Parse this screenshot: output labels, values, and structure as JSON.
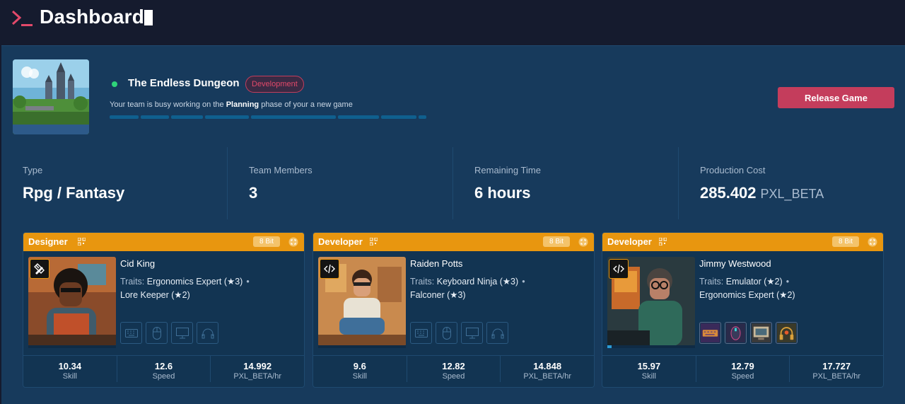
{
  "header": {
    "title": "Dashboard"
  },
  "project": {
    "name": "The Endless Dungeon",
    "phase_badge": "Development",
    "status_prefix": "Your team is busy working on the ",
    "status_phase": "Planning",
    "status_suffix": " phase of your a new game",
    "progress_fraction": 0.07,
    "release_label": "Release Game"
  },
  "stats": [
    {
      "label": "Type",
      "value": "Rpg / Fantasy",
      "unit": ""
    },
    {
      "label": "Team Members",
      "value": "3",
      "unit": ""
    },
    {
      "label": "Remaining Time",
      "value": "6 hours",
      "unit": ""
    },
    {
      "label": "Production Cost",
      "value": "285.402",
      "unit": "PXL_BETA"
    }
  ],
  "members": [
    {
      "role": "Designer",
      "bit": "8 Bit",
      "role_icon": "pencil-ruler-icon",
      "name": "Cid King",
      "traits_label": "Traits:",
      "trait_1": "Ergonomics Expert (★3)",
      "trait_2": "Lore Keeper (★2)",
      "equipment": [
        "keyboard-icon",
        "mouse-icon",
        "monitor-icon",
        "headphones-icon"
      ],
      "skill": "10.34",
      "speed": "12.6",
      "rate": "14.992",
      "skill_label": "Skill",
      "speed_label": "Speed",
      "rate_label": "PXL_BETA/hr"
    },
    {
      "role": "Developer",
      "bit": "8 Bit",
      "role_icon": "code-icon",
      "name": "Raiden Potts",
      "traits_label": "Traits:",
      "trait_1": "Keyboard Ninja (★3)",
      "trait_2": "Falconer (★3)",
      "equipment": [
        "keyboard-icon",
        "mouse-icon",
        "monitor-icon",
        "headphones-icon"
      ],
      "skill": "9.6",
      "speed": "12.82",
      "rate": "14.848",
      "skill_label": "Skill",
      "speed_label": "Speed",
      "rate_label": "PXL_BETA/hr"
    },
    {
      "role": "Developer",
      "bit": "8 Bit",
      "role_icon": "code-icon",
      "name": "Jimmy Westwood",
      "traits_label": "Traits:",
      "trait_1": "Emulator (★2)",
      "trait_2": "Ergonomics Expert (★2)",
      "equipment": [
        "keyboard-icon",
        "mouse-icon",
        "monitor-icon",
        "headphones-icon"
      ],
      "skill": "15.97",
      "speed": "12.79",
      "rate": "17.727",
      "skill_label": "Skill",
      "speed_label": "Speed",
      "rate_label": "PXL_BETA/hr"
    }
  ],
  "colors": {
    "accent": "#c43d5c",
    "card_header": "#e8960f",
    "panel": "#173a5c",
    "background": "#151b2e"
  }
}
